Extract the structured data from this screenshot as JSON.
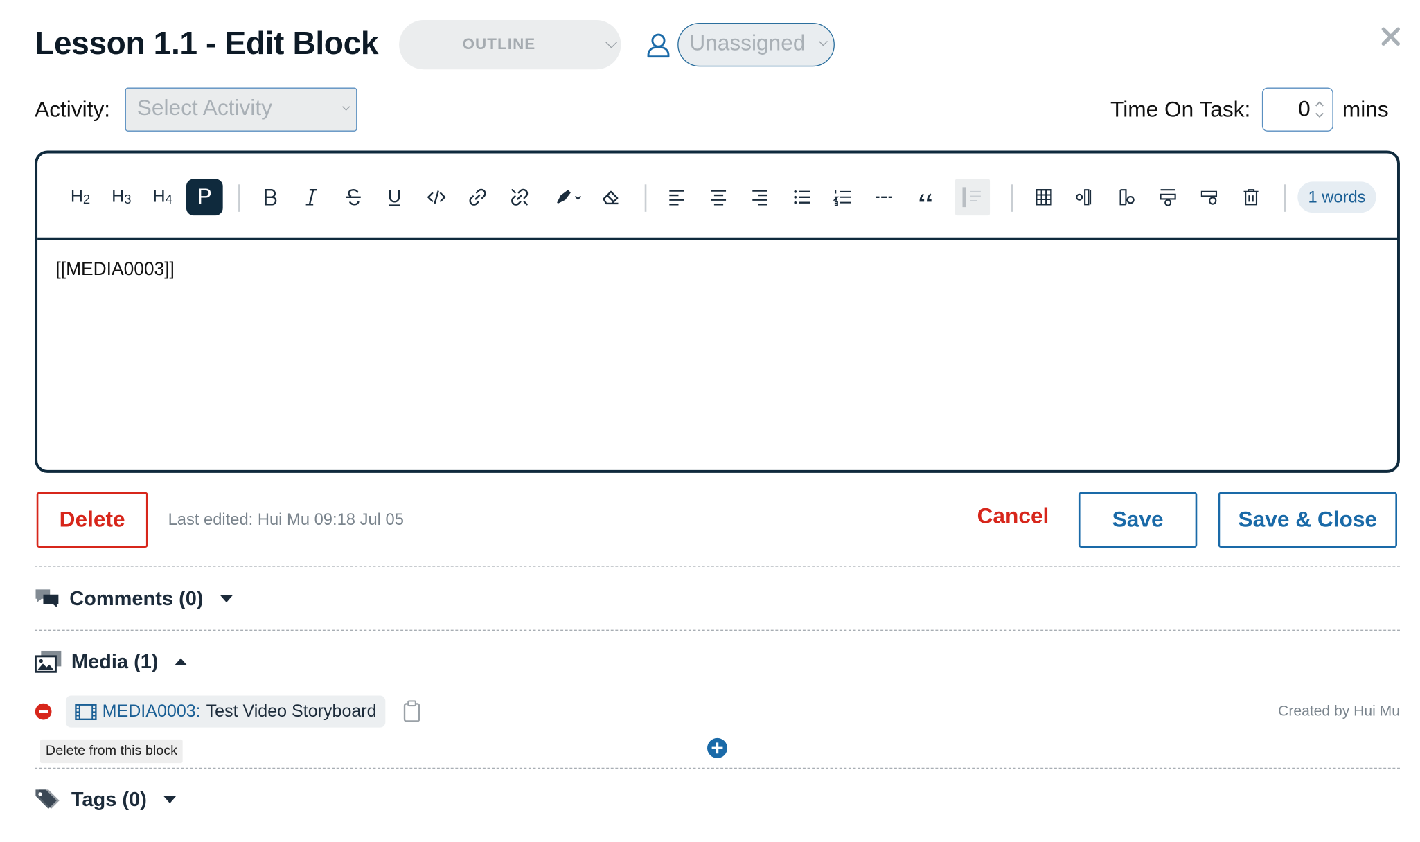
{
  "header": {
    "title": "Lesson 1.1 - Edit Block",
    "status_select": "OUTLINE",
    "assignee_select": "Unassigned"
  },
  "activity": {
    "label": "Activity:",
    "placeholder": "Select Activity"
  },
  "time_on_task": {
    "label": "Time On Task:",
    "value": "0",
    "unit": "mins"
  },
  "toolbar": {
    "heading_buttons": [
      "H2",
      "H3",
      "H4",
      "P"
    ],
    "active_format": "P",
    "word_count": "1 words",
    "icons": [
      "bold-icon",
      "italic-icon",
      "strikethrough-icon",
      "underline-icon",
      "code-icon",
      "link-icon",
      "unlink-icon",
      "highlight-icon",
      "clear-format-icon",
      "align-left-icon",
      "align-center-icon",
      "align-right-icon",
      "bullet-list-icon",
      "numbered-list-icon",
      "horizontal-rule-icon",
      "blockquote-icon",
      "indent-icon",
      "table-icon",
      "add-column-icon",
      "delete-column-icon",
      "add-row-icon",
      "delete-row-icon",
      "delete-table-icon"
    ]
  },
  "editor": {
    "content": "[[MEDIA0003]]"
  },
  "actions": {
    "delete": "Delete",
    "last_edited": "Last edited: Hui Mu 09:18 Jul 05",
    "cancel": "Cancel",
    "save": "Save",
    "save_close": "Save & Close"
  },
  "comments": {
    "label": "Comments (0)"
  },
  "media": {
    "label": "Media (1)",
    "items": [
      {
        "id": "MEDIA0003:",
        "name": "Test Video Storyboard",
        "created_by": "Created by Hui Mu"
      }
    ],
    "tooltip": "Delete from this block"
  },
  "tags": {
    "label": "Tags (0)"
  },
  "colors": {
    "primary": "#1a6aa8",
    "danger": "#d7261b",
    "dark": "#0f2a3d"
  }
}
